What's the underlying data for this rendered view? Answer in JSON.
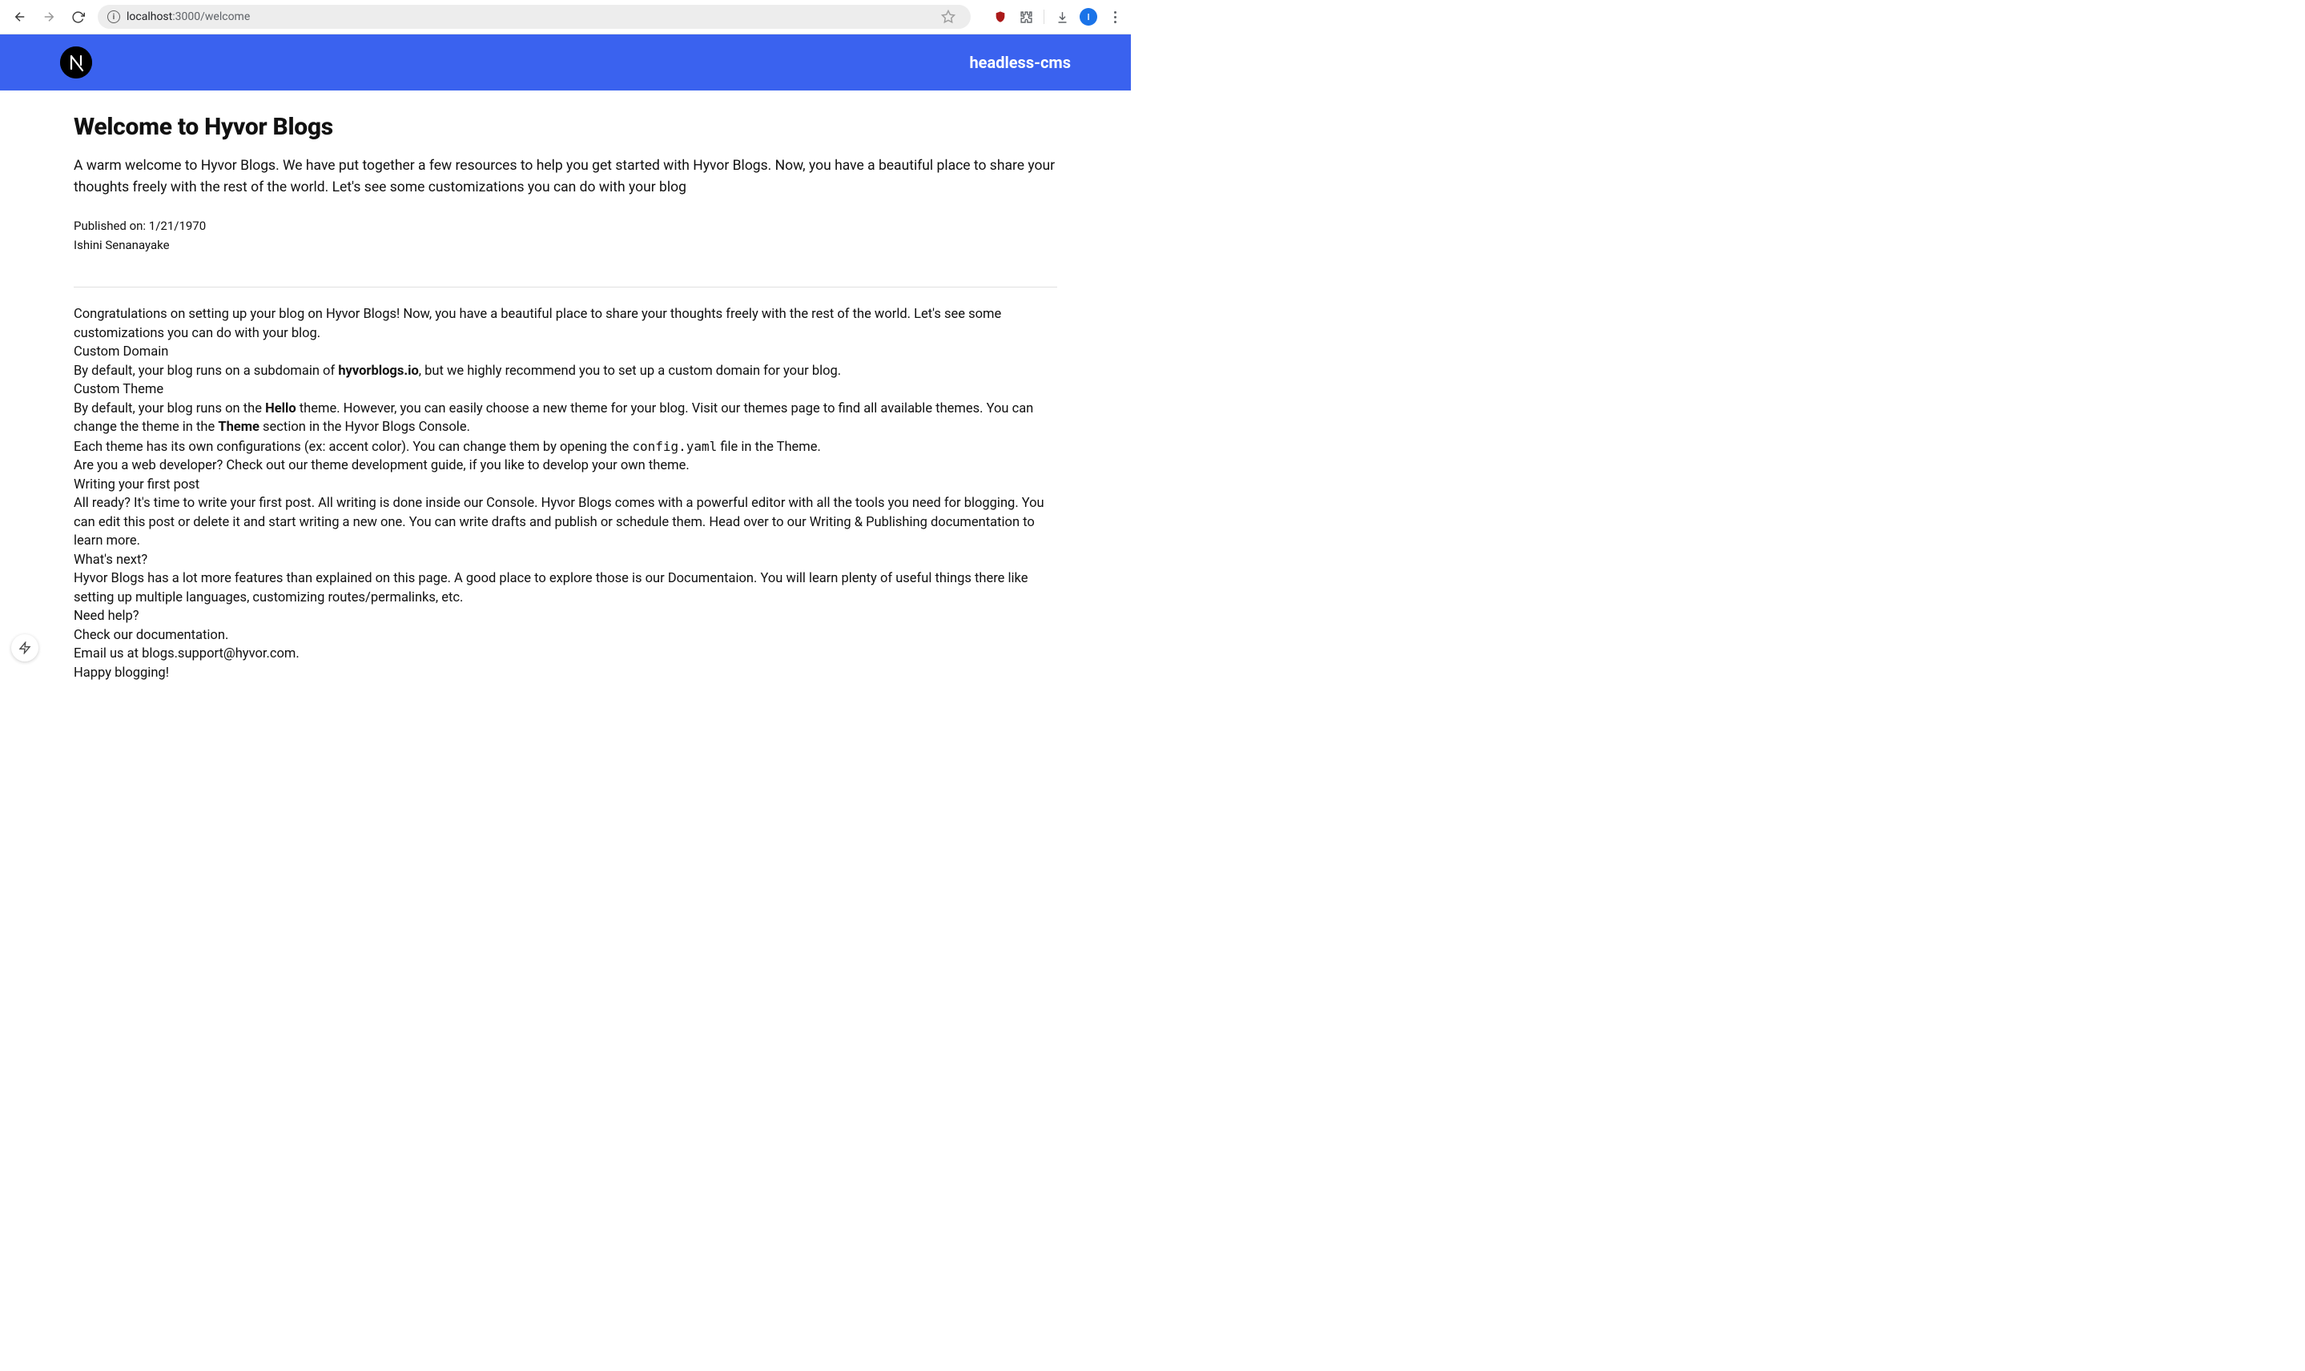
{
  "browser": {
    "url_host": "localhost",
    "url_path": ":3000/welcome",
    "avatar_initial": "I"
  },
  "header": {
    "app_title": "headless-cms"
  },
  "post": {
    "title": "Welcome to Hyvor Blogs",
    "intro": "A warm welcome to Hyvor Blogs. We have put together a few resources to help you get started with Hyvor Blogs. Now, you have a beautiful place to share your thoughts freely with the rest of the world. Let's see some customizations you can do with your blog",
    "published_label": "Published on: ",
    "published_date": "1/21/1970",
    "author": "Ishini Senanayake"
  },
  "body": {
    "p1": "Congratulations on setting up your blog on Hyvor Blogs! Now, you have a beautiful place to share your thoughts freely with the rest of the world. Let's see some customizations you can do with your blog.",
    "h_custom_domain": "Custom Domain",
    "p2a": "By default, your blog runs on a subdomain of ",
    "p2_bold": "hyvorblogs.io",
    "p2b": ", but we highly recommend you to set up a custom domain for your blog.",
    "h_custom_theme": "Custom Theme",
    "p3a": "By default, your blog runs on the ",
    "p3_bold1": "Hello",
    "p3b": " theme. However, you can easily choose a new theme for your blog. Visit our themes page to find all available themes. You can change the theme in the ",
    "p3_bold2": "Theme",
    "p3c": " section in the Hyvor Blogs Console.",
    "p4a": "Each theme has its own configurations (ex: accent color). You can change them by opening the ",
    "p4_code": "config.yaml",
    "p4b": " file in the Theme.",
    "p5": "Are you a web developer? Check out our theme development guide, if you like to develop your own theme.",
    "h_writing": "Writing your first post",
    "p6": "All ready? It's time to write your first post. All writing is done inside our Console. Hyvor Blogs comes with a powerful editor with all the tools you need for blogging. You can edit this post or delete it and start writing a new one. You can write drafts and publish or schedule them. Head over to our Writing & Publishing documentation to learn more.",
    "h_next": "What's next?",
    "p7": "Hyvor Blogs has a lot more features than explained on this page. A good place to explore those is our Documentaion. You will learn plenty of useful things there like setting up multiple languages, customizing routes/permalinks, etc.",
    "h_help": "Need help?",
    "p8": "Check our documentation.",
    "p9": "Email us at blogs.support@hyvor.com.",
    "p10": "Happy blogging!"
  }
}
